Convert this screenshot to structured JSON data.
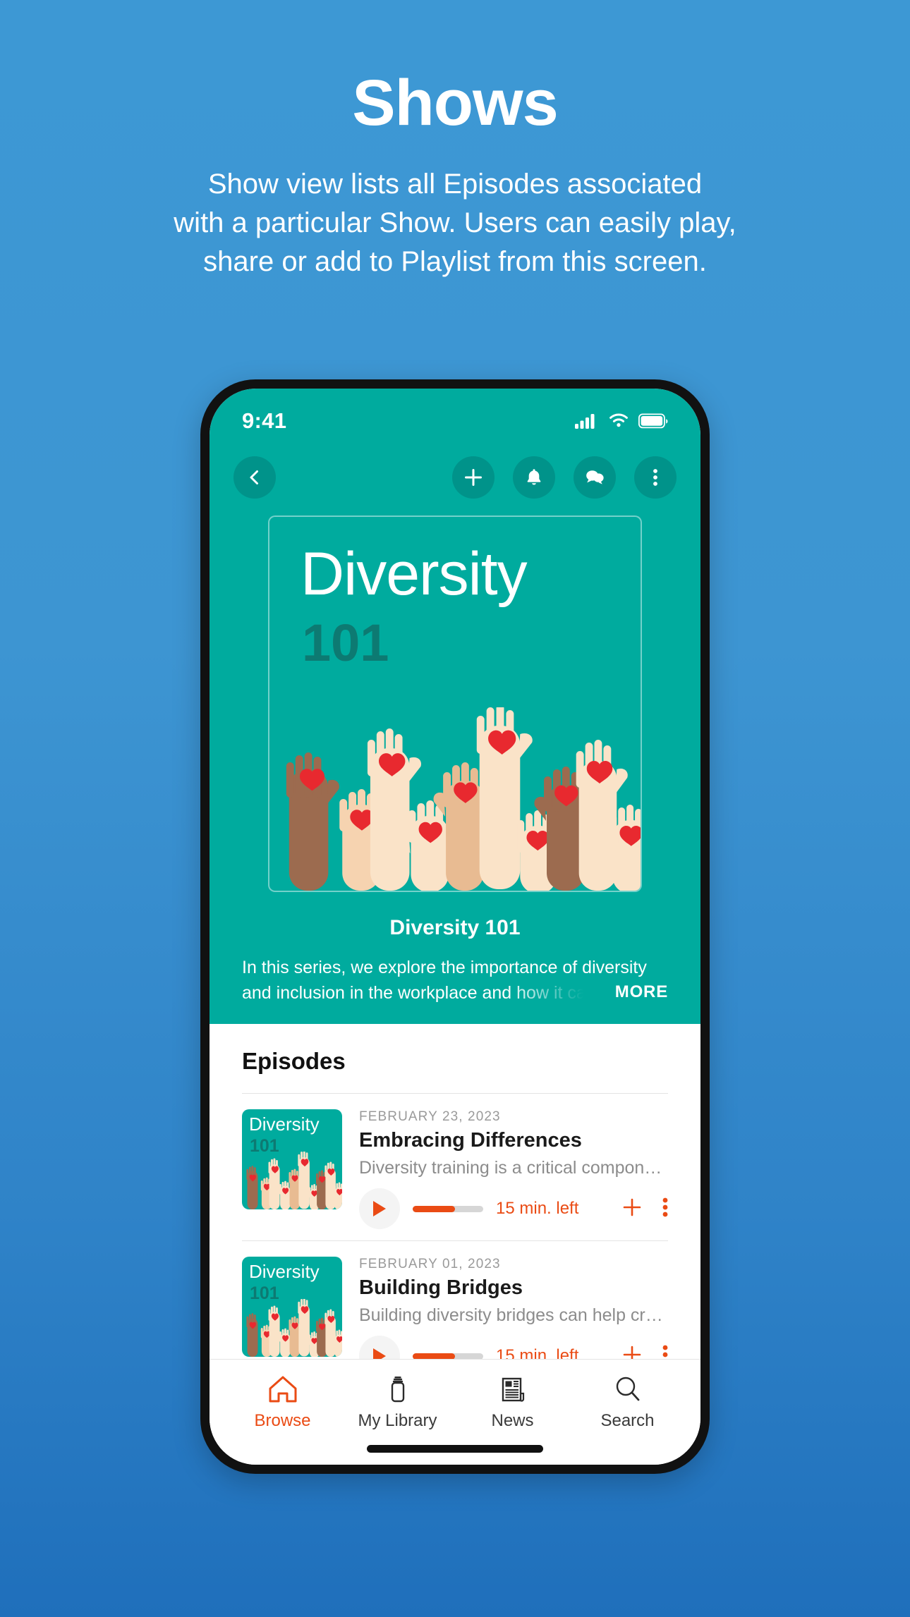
{
  "promo": {
    "title": "Shows",
    "subtitle_lines": [
      "Show view lists all Episodes associated",
      "with a particular Show. Users can easily play,",
      "share or add to Playlist from this screen."
    ]
  },
  "colors": {
    "page_background": "#3d95d2",
    "app_teal": "#00ab9e",
    "app_teal_dark": "#00938a",
    "cover_number": "#0d7a72",
    "accent_orange": "#ea4b14",
    "heart_red": "#e8292f",
    "text_dark": "#1a1a1a",
    "text_muted": "#8c8c8c",
    "date_grey": "#9a9a9a"
  },
  "status_bar": {
    "time": "9:41",
    "icons": [
      "cellular-signal-icon",
      "wifi-icon",
      "battery-icon"
    ]
  },
  "top_nav": {
    "back": {
      "icon": "chevron-left-icon",
      "label": "Back"
    },
    "actions": [
      {
        "icon": "plus-icon",
        "label": "Add"
      },
      {
        "icon": "bell-icon",
        "label": "Notifications"
      },
      {
        "icon": "chat-bubbles-icon",
        "label": "Comments"
      },
      {
        "icon": "more-vertical-icon",
        "label": "More options"
      }
    ]
  },
  "show": {
    "cover_title": "Diversity",
    "cover_number": "101",
    "cover_art_name": "raised-hands-with-hearts-illustration",
    "title": "Diversity 101",
    "description": "In this series, we explore the importance of diversity and inclusion in the workplace and how it can benefit",
    "more_label": "MORE"
  },
  "episodes_section": {
    "heading": "Episodes",
    "items": [
      {
        "thumb_title": "Diversity",
        "thumb_number": "101",
        "date": "FEBRUARY 23, 2023",
        "title": "Embracing Differences",
        "description": "Diversity training is a critical component of any...",
        "time_left": "15 min. left",
        "progress_percent": 60,
        "play_label": "Play",
        "add_label": "Add to playlist",
        "more_label": "More options"
      },
      {
        "thumb_title": "Diversity",
        "thumb_number": "101",
        "date": "FEBRUARY 01, 2023",
        "title": "Building Bridges",
        "description": "Building diversity bridges can help create a mor...",
        "time_left": "15 min. left",
        "progress_percent": 60,
        "play_label": "Play",
        "add_label": "Add to playlist",
        "more_label": "More options"
      }
    ]
  },
  "tab_bar": {
    "tabs": [
      {
        "label": "Browse",
        "icon": "home-icon",
        "active": true
      },
      {
        "label": "My Library",
        "icon": "library-jar-icon",
        "active": false
      },
      {
        "label": "News",
        "icon": "newspaper-icon",
        "active": false
      },
      {
        "label": "Search",
        "icon": "magnifier-icon",
        "active": false
      }
    ]
  }
}
